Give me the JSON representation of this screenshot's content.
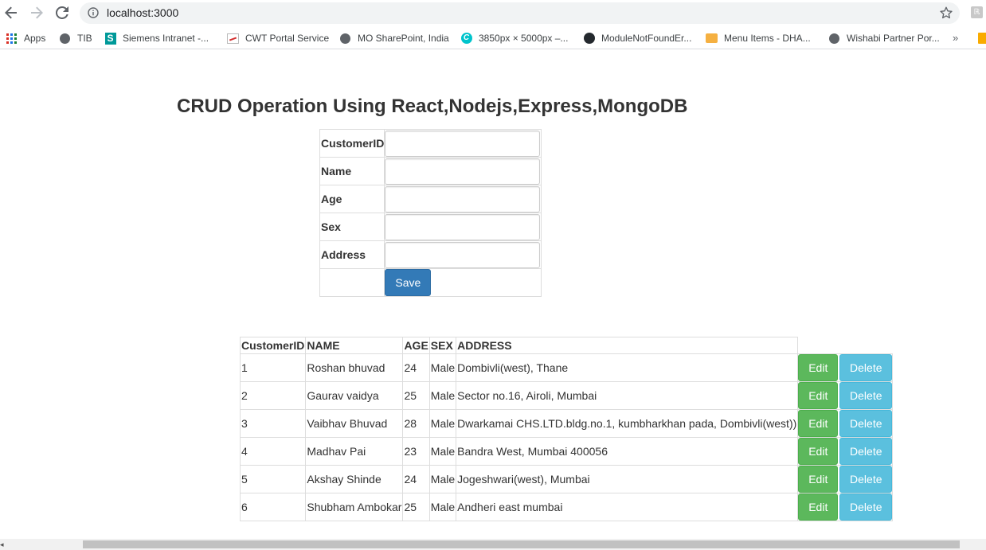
{
  "browser": {
    "url": "localhost:3000",
    "bookmarks": [
      {
        "label": "Apps",
        "icon": "apps-grid-icon"
      },
      {
        "label": "TIB",
        "icon": "globe-icon"
      },
      {
        "label": "Siemens Intranet -...",
        "icon": "siemens-s-icon"
      },
      {
        "label": "CWT Portal Service",
        "icon": "cwt-icon"
      },
      {
        "label": "MO SharePoint, India",
        "icon": "globe-icon"
      },
      {
        "label": "3850px × 5000px –...",
        "icon": "canva-icon"
      },
      {
        "label": "ModuleNotFoundEr...",
        "icon": "github-icon"
      },
      {
        "label": "Menu Items - DHA...",
        "icon": "menu-icon"
      },
      {
        "label": "Wishabi Partner Por...",
        "icon": "globe-icon"
      }
    ],
    "more_label": "»"
  },
  "page": {
    "title": "CRUD Operation Using React,Nodejs,Express,MongoDB"
  },
  "form": {
    "fields": [
      {
        "label": "CustomerID",
        "value": ""
      },
      {
        "label": "Name",
        "value": ""
      },
      {
        "label": "Age",
        "value": ""
      },
      {
        "label": "Sex",
        "value": ""
      },
      {
        "label": "Address",
        "value": ""
      }
    ],
    "save_label": "Save"
  },
  "table": {
    "headers": [
      "CustomerID",
      "NAME",
      "AGE",
      "SEX",
      "ADDRESS"
    ],
    "edit_label": "Edit",
    "delete_label": "Delete",
    "rows": [
      {
        "id": "1",
        "name": "Roshan bhuvad",
        "age": "24",
        "sex": "Male",
        "address": "Dombivli(west), Thane"
      },
      {
        "id": "2",
        "name": "Gaurav vaidya",
        "age": "25",
        "sex": "Male",
        "address": "Sector no.16, Airoli, Mumbai"
      },
      {
        "id": "3",
        "name": "Vaibhav Bhuvad",
        "age": "28",
        "sex": "Male",
        "address": "Dwarkamai CHS.LTD.bldg.no.1, kumbharkhan pada, Dombivli(west))"
      },
      {
        "id": "4",
        "name": "Madhav Pai",
        "age": "23",
        "sex": "Male",
        "address": "Bandra West, Mumbai 400056"
      },
      {
        "id": "5",
        "name": "Akshay Shinde",
        "age": "24",
        "sex": "Male",
        "address": "Jogeshwari(west), Mumbai"
      },
      {
        "id": "6",
        "name": "Shubham Ambokar",
        "age": "25",
        "sex": "Male",
        "address": "Andheri east mumbai"
      }
    ]
  },
  "colors": {
    "save": "#337ab7",
    "edit": "#5cb85c",
    "delete": "#5bc0de"
  }
}
